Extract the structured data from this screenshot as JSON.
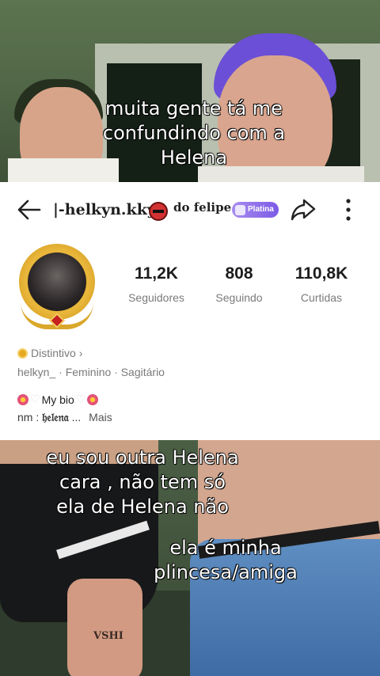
{
  "captions": {
    "top": [
      "muita gente tá me",
      "confundindo com a",
      "Helena"
    ],
    "middle": [
      "eu sou outra Helena",
      "cara , não tem só",
      "ela de Helena não"
    ],
    "lower": [
      "ela é minha",
      "plincesa/amiga"
    ]
  },
  "profile": {
    "username": "|-helkyn.kky",
    "tag": "do felipe",
    "badge": "Platina",
    "stats": [
      {
        "value": "11,2K",
        "label": "Seguidores"
      },
      {
        "value": "808",
        "label": "Seguindo"
      },
      {
        "value": "110,8K",
        "label": "Curtidas"
      }
    ],
    "distintivo": "Distintivo",
    "distintivo_chevron": "›",
    "info": "helkyn_ · Feminino · Sagitário",
    "bio_title": "My bio",
    "bio_prefix": "nm : ",
    "bio_name": "𝔥𝔢𝔩𝔢𝔫𝔞",
    "bio_ellipsis": "...",
    "more_label": "Mais"
  },
  "overlay": {
    "tattoo": "VSHI"
  },
  "icons": {
    "back": "back-arrow-icon",
    "share": "share-icon",
    "more": "more-vertical-icon",
    "no_smoking": "no-smoking-icon",
    "badge": "distintivo-badge-icon",
    "flower": "flower-icon",
    "heart": "white-heart-icon"
  },
  "colors": {
    "platina_badge": "#8d6cf0",
    "text_muted": "#7a7a7a",
    "text_dark": "#1c1c1c"
  }
}
